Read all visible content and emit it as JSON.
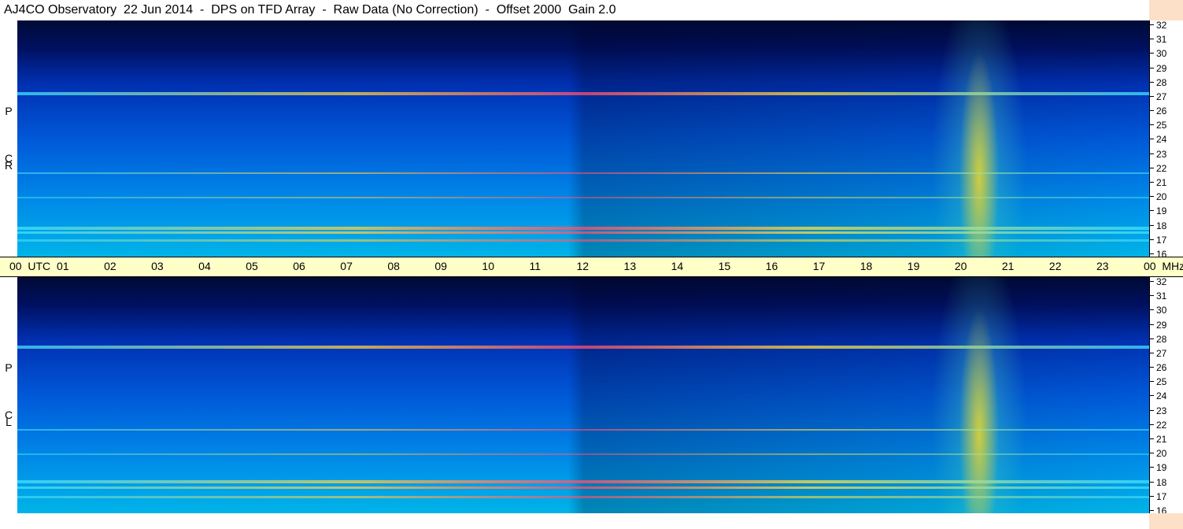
{
  "header": {
    "title": "AJ4CO Observatory  22 Jun 2014  -  DPS on TFD Array  -  Raw Data (No Correction)  -  Offset 2000  Gain 2.0"
  },
  "panels": [
    {
      "polarization": [
        "R",
        "C",
        "P"
      ]
    },
    {
      "polarization": [
        "L",
        "C",
        "P"
      ]
    }
  ],
  "frequency_axis": {
    "unit": "MHz",
    "ticks": [
      "32",
      "31",
      "30",
      "29",
      "28",
      "27",
      "26",
      "25",
      "24",
      "23",
      "22",
      "21",
      "20",
      "19",
      "18",
      "17",
      "16"
    ]
  },
  "time_axis": {
    "labels": [
      "00  UTC",
      "01",
      "02",
      "03",
      "04",
      "05",
      "06",
      "07",
      "08",
      "09",
      "10",
      "11",
      "12",
      "13",
      "14",
      "15",
      "16",
      "17",
      "18",
      "19",
      "20",
      "21",
      "22",
      "23",
      "00  MHz"
    ]
  },
  "colors": {
    "time_axis_bg": "#ffffc8",
    "right_strip_bg": "#fde0c8",
    "spectrogram_low": "#000a35",
    "spectrogram_mid": "#0058d8",
    "spectrogram_high": "#ffe040",
    "spectrogram_peak": "#ff5070"
  }
}
